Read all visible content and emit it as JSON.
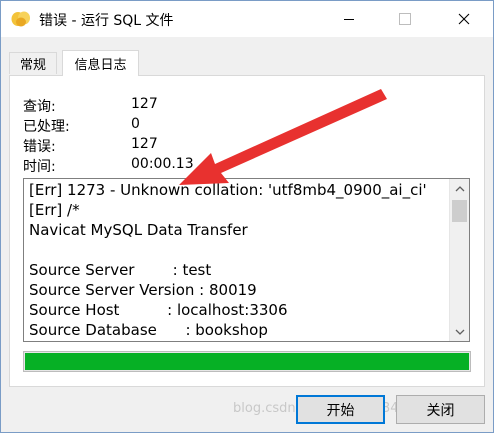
{
  "window": {
    "title": "错误 - 运行 SQL 文件"
  },
  "tabs": [
    {
      "label": "常规",
      "active": false
    },
    {
      "label": "信息日志",
      "active": true
    }
  ],
  "stats": [
    {
      "label": "查询:",
      "value": "127"
    },
    {
      "label": "已处理:",
      "value": "0"
    },
    {
      "label": "错误:",
      "value": "127"
    },
    {
      "label": "时间:",
      "value": "00:00.13"
    }
  ],
  "log": {
    "lines": [
      "[Err] 1273 - Unknown collation: 'utf8mb4_0900_ai_ci'",
      "[Err] /*",
      "Navicat MySQL Data Transfer",
      "",
      "Source Server        : test",
      "Source Server Version : 80019",
      "Source Host          : localhost:3306",
      "Source Database      : bookshop"
    ]
  },
  "progress": {
    "percent": 100,
    "color": "#06b025"
  },
  "buttons": {
    "start": "开始",
    "close": "关闭"
  },
  "watermark": "blog.csdn.net/weixin_43492229",
  "colors": {
    "accent": "#0078d7",
    "annotation_arrow": "#e8312f"
  }
}
